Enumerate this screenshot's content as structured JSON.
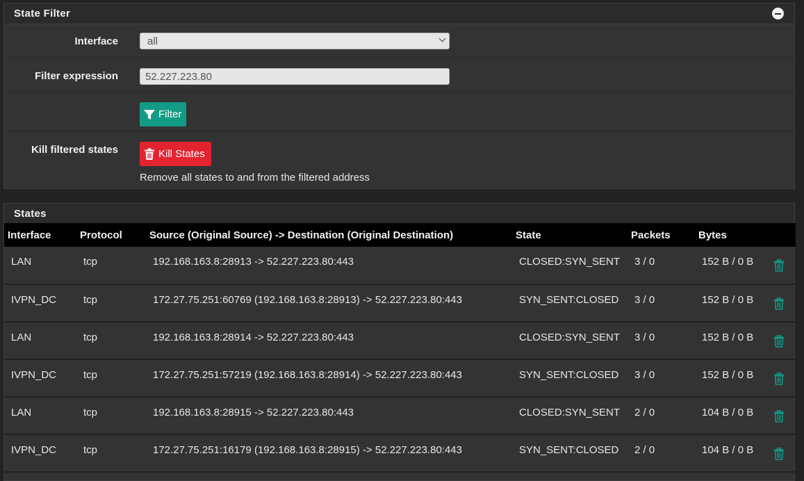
{
  "state_filter": {
    "title": "State Filter",
    "interface_label": "Interface",
    "interface_value": "all",
    "filter_expression_label": "Filter expression",
    "filter_expression_value": "52.227.223.80",
    "filter_button_label": "Filter",
    "kill_label": "Kill filtered states",
    "kill_button_label": "Kill States",
    "kill_help": "Remove all states to and from the filtered address"
  },
  "states": {
    "title": "States",
    "columns": [
      "Interface",
      "Protocol",
      "Source (Original Source) -> Destination (Original Destination)",
      "State",
      "Packets",
      "Bytes"
    ],
    "rows": [
      {
        "interface": "LAN",
        "protocol": "tcp",
        "flow": "192.168.163.8:28913 -> 52.227.223.80:443",
        "state": "CLOSED:SYN_SENT",
        "packets": "3 / 0",
        "bytes": "152 B / 0 B"
      },
      {
        "interface": "IVPN_DC",
        "protocol": "tcp",
        "flow": "172.27.75.251:60769 (192.168.163.8:28913) -> 52.227.223.80:443",
        "state": "SYN_SENT:CLOSED",
        "packets": "3 / 0",
        "bytes": "152 B / 0 B"
      },
      {
        "interface": "LAN",
        "protocol": "tcp",
        "flow": "192.168.163.8:28914 -> 52.227.223.80:443",
        "state": "CLOSED:SYN_SENT",
        "packets": "3 / 0",
        "bytes": "152 B / 0 B"
      },
      {
        "interface": "IVPN_DC",
        "protocol": "tcp",
        "flow": "172.27.75.251:57219 (192.168.163.8:28914) -> 52.227.223.80:443",
        "state": "SYN_SENT:CLOSED",
        "packets": "3 / 0",
        "bytes": "152 B / 0 B"
      },
      {
        "interface": "LAN",
        "protocol": "tcp",
        "flow": "192.168.163.8:28915 -> 52.227.223.80:443",
        "state": "CLOSED:SYN_SENT",
        "packets": "2 / 0",
        "bytes": "104 B / 0 B"
      },
      {
        "interface": "IVPN_DC",
        "protocol": "tcp",
        "flow": "172.27.75.251:16179 (192.168.163.8:28915) -> 52.227.223.80:443",
        "state": "SYN_SENT:CLOSED",
        "packets": "2 / 0",
        "bytes": "104 B / 0 B"
      }
    ]
  },
  "icons": {
    "collapse": "minus-circle-icon",
    "filter": "filter-icon",
    "trash": "trash-icon"
  },
  "colors": {
    "filter_button": "#129b85",
    "kill_button": "#e42330",
    "trash_icon": "#129b85",
    "table_header": "#000000"
  }
}
